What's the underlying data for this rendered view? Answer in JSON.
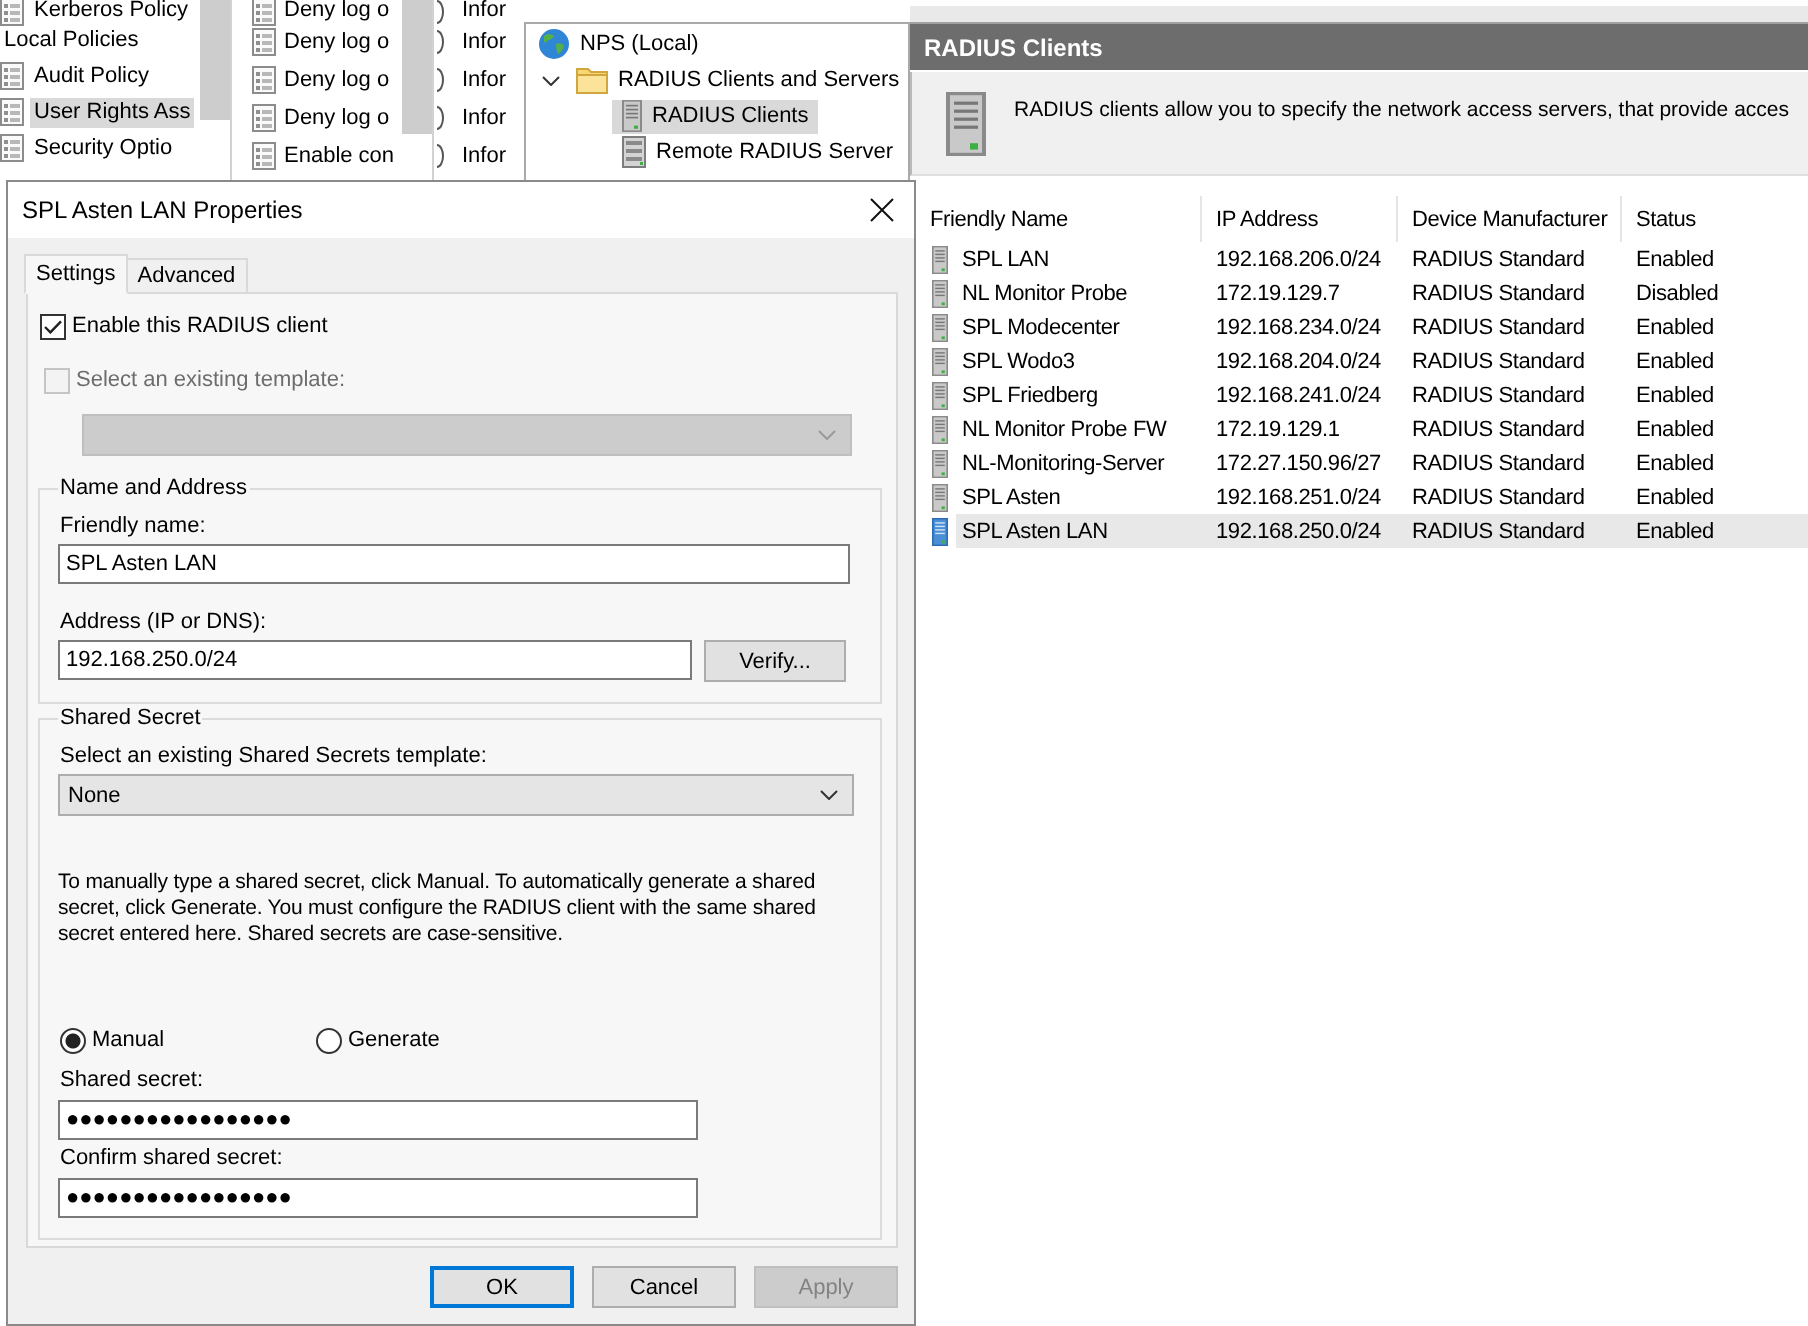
{
  "policy_tree": {
    "items": [
      {
        "label": "Kerberos Policy",
        "selected": false
      },
      {
        "label": "Local Policies",
        "selected": false,
        "children": [
          {
            "label": "Audit Policy",
            "selected": false
          },
          {
            "label": "User Rights Ass",
            "selected": true
          },
          {
            "label": "Security Optio",
            "selected": false
          }
        ]
      }
    ]
  },
  "policy_list": {
    "items": [
      "Deny log o",
      "Deny log o",
      "Deny log o",
      "Deny log o",
      "Enable con"
    ]
  },
  "column_3": {
    "items": [
      "Infor",
      "Infor",
      "Infor",
      "Infor",
      "Infor"
    ]
  },
  "nps_tree": {
    "items": [
      {
        "label": "NPS (Local)",
        "kind": "globe",
        "selected": false,
        "children": [
          {
            "label": "RADIUS Clients and Servers",
            "kind": "folder",
            "selected": false,
            "expanded": true,
            "children": [
              {
                "label": "RADIUS Clients",
                "kind": "server",
                "selected": true
              },
              {
                "label": "Remote RADIUS Server",
                "kind": "server-group",
                "selected": false
              }
            ]
          }
        ]
      }
    ]
  },
  "details": {
    "title": "RADIUS Clients",
    "description": "RADIUS clients allow you to specify the network access servers, that provide acces",
    "table": {
      "columns": [
        "Friendly Name",
        "IP Address",
        "Device Manufacturer",
        "Status"
      ],
      "rows": [
        {
          "cells": [
            "SPL LAN",
            "192.168.206.0/24",
            "RADIUS Standard",
            "Enabled"
          ],
          "selected": false
        },
        {
          "cells": [
            "NL Monitor Probe",
            "172.19.129.7",
            "RADIUS Standard",
            "Disabled"
          ],
          "selected": false
        },
        {
          "cells": [
            "SPL Modecenter",
            "192.168.234.0/24",
            "RADIUS Standard",
            "Enabled"
          ],
          "selected": false
        },
        {
          "cells": [
            "SPL Wodo3",
            "192.168.204.0/24",
            "RADIUS Standard",
            "Enabled"
          ],
          "selected": false
        },
        {
          "cells": [
            "SPL Friedberg",
            "192.168.241.0/24",
            "RADIUS Standard",
            "Enabled"
          ],
          "selected": false
        },
        {
          "cells": [
            "NL Monitor Probe FW",
            "172.19.129.1",
            "RADIUS Standard",
            "Enabled"
          ],
          "selected": false
        },
        {
          "cells": [
            "NL-Monitoring-Server",
            "172.27.150.96/27",
            "RADIUS Standard",
            "Enabled"
          ],
          "selected": false
        },
        {
          "cells": [
            "SPL Asten",
            "192.168.251.0/24",
            "RADIUS Standard",
            "Enabled"
          ],
          "selected": false
        },
        {
          "cells": [
            "SPL Asten LAN",
            "192.168.250.0/24",
            "RADIUS Standard",
            "Enabled"
          ],
          "selected": true
        }
      ]
    }
  },
  "dialog": {
    "title": "SPL Asten LAN Properties",
    "tabs": [
      {
        "label": "Settings",
        "selected": true
      },
      {
        "label": "Advanced",
        "selected": false
      }
    ],
    "enable_client": {
      "label": "Enable this RADIUS client",
      "checked": true,
      "disabled": false
    },
    "use_template": {
      "label": "Select an existing template:",
      "checked": false,
      "disabled": true
    },
    "template_dropdown": {
      "disabled": true
    },
    "name_and_address": {
      "legend": "Name and Address",
      "friendly_name": {
        "label": "Friendly name:",
        "value": "SPL Asten LAN"
      },
      "address": {
        "label": "Address (IP or DNS):",
        "value": "192.168.250.0/24"
      },
      "verify_button": "Verify..."
    },
    "shared_secret": {
      "legend": "Shared Secret",
      "template_label": "Select an existing Shared Secrets template:",
      "template_dropdown": {
        "value": "None",
        "disabled": false
      },
      "help": "To manually type a shared secret, click Manual. To automatically generate a shared secret, click Generate. You must configure the RADIUS client with the same shared secret entered here. Shared secrets are case-sensitive.",
      "modes": [
        {
          "label": "Manual",
          "selected": true
        },
        {
          "label": "Generate",
          "selected": false
        }
      ],
      "secret": {
        "label": "Shared secret:",
        "value": "●●●●●●●●●●●●●●●●●"
      },
      "confirm": {
        "label": "Confirm shared secret:",
        "value": "●●●●●●●●●●●●●●●●●"
      }
    },
    "buttons": [
      {
        "label": "OK",
        "default": true,
        "disabled": false
      },
      {
        "label": "Cancel",
        "default": false,
        "disabled": false
      },
      {
        "label": "Apply",
        "default": false,
        "disabled": true
      }
    ]
  }
}
